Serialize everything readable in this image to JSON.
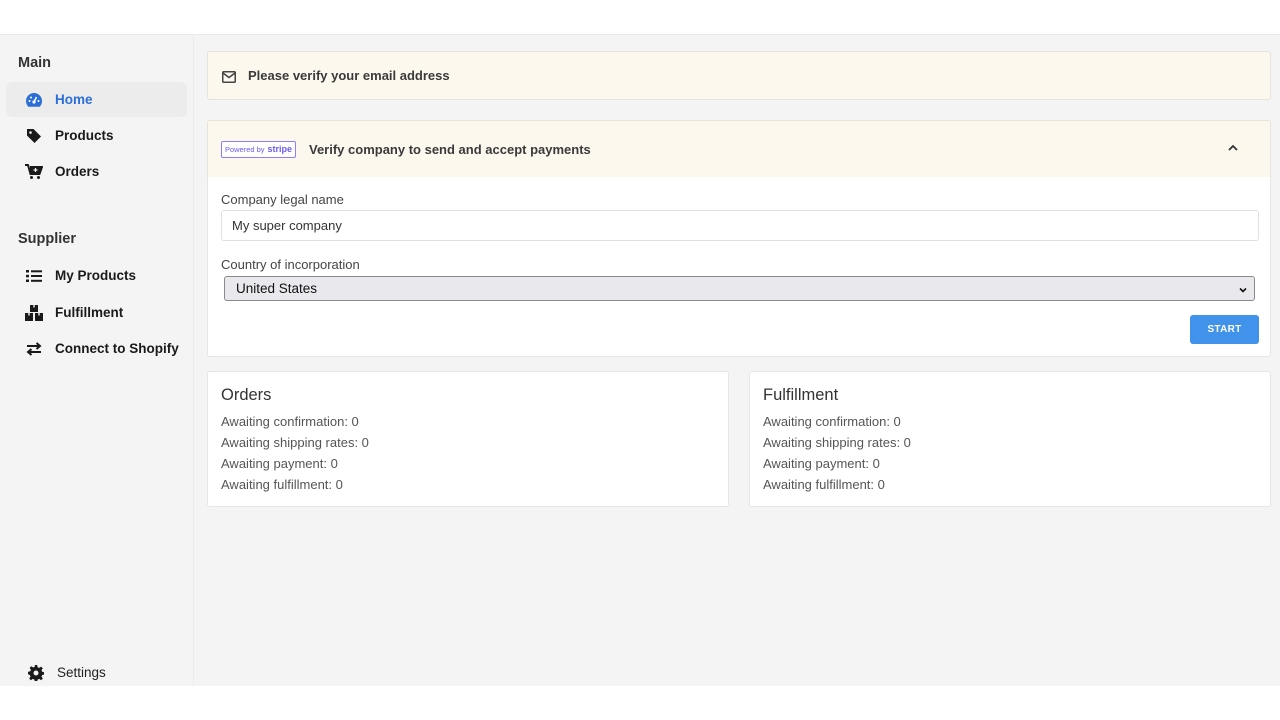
{
  "sidebar": {
    "sections": [
      {
        "title": "Main",
        "items": [
          {
            "label": "Home",
            "icon": "dashboard-icon",
            "active": true
          },
          {
            "label": "Products",
            "icon": "tag-icon",
            "active": false
          },
          {
            "label": "Orders",
            "icon": "cart-icon",
            "active": false
          }
        ]
      },
      {
        "title": "Supplier",
        "items": [
          {
            "label": "My Products",
            "icon": "list-icon",
            "active": false
          },
          {
            "label": "Fulfillment",
            "icon": "boxes-icon",
            "active": false
          },
          {
            "label": "Connect to Shopify",
            "icon": "exchange-icon",
            "active": false
          }
        ]
      }
    ],
    "footer": {
      "label": "Settings",
      "icon": "gear-icon"
    }
  },
  "email_banner": {
    "text": "Please verify your email address",
    "icon": "envelope-icon"
  },
  "stripe_panel": {
    "badge_prefix": "Powered by",
    "badge_brand": "stripe",
    "title": "Verify company to send and accept payments",
    "collapse_icon": "chevron-up-icon",
    "company_label": "Company legal name",
    "company_value": "My super company",
    "country_label": "Country of incorporation",
    "country_value": "United States",
    "start_label": "START"
  },
  "cards": [
    {
      "title": "Orders",
      "rows": [
        "Awaiting confirmation: 0",
        "Awaiting shipping rates: 0",
        "Awaiting payment: 0",
        "Awaiting fulfillment: 0"
      ]
    },
    {
      "title": "Fulfillment",
      "rows": [
        "Awaiting confirmation: 0",
        "Awaiting shipping rates: 0",
        "Awaiting payment: 0",
        "Awaiting fulfillment: 0"
      ]
    }
  ],
  "colors": {
    "accent": "#2b6fd6",
    "button": "#4092ea",
    "banner_bg": "#fdf8ee",
    "stripe": "#6a5cf0"
  }
}
